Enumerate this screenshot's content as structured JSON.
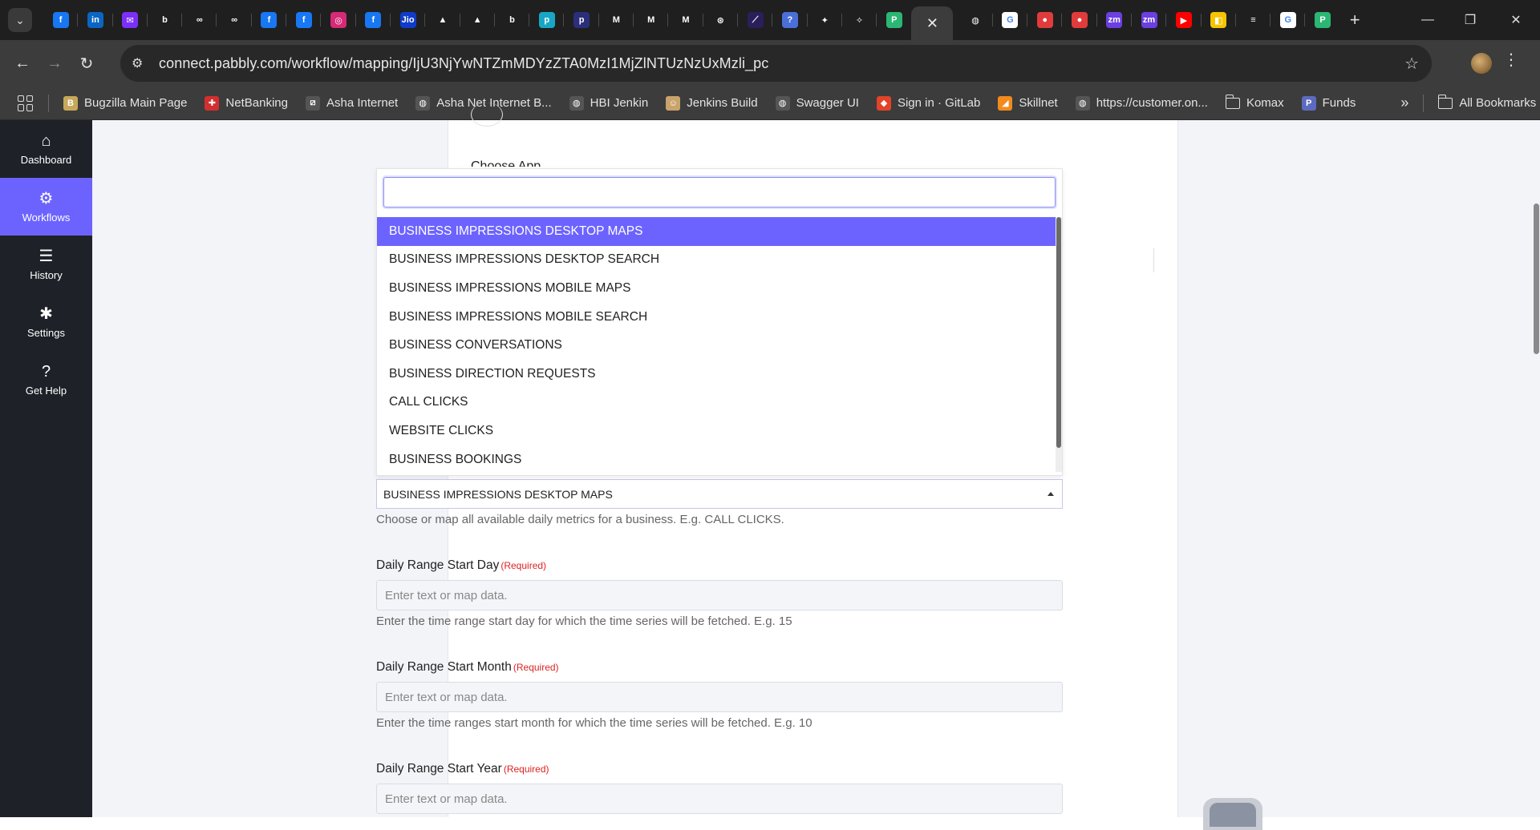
{
  "browser": {
    "tab_icons": [
      {
        "name": "facebook-tab-icon",
        "bg": "#1877f2",
        "glyph": "f"
      },
      {
        "name": "linkedin-tab-icon",
        "bg": "#0a66c2",
        "glyph": "in"
      },
      {
        "name": "mail-tab-icon",
        "bg": "#7b2ff7",
        "glyph": "✉"
      },
      {
        "name": "bonsai-tab-icon",
        "bg": "#1f1f1f",
        "glyph": "b"
      },
      {
        "name": "meta-tab-icon",
        "bg": "#1f1f1f",
        "glyph": "∞"
      },
      {
        "name": "meta-tab-icon",
        "bg": "#1f1f1f",
        "glyph": "∞"
      },
      {
        "name": "facebook-tab-icon",
        "bg": "#1877f2",
        "glyph": "f"
      },
      {
        "name": "facebook-tab-icon",
        "bg": "#1877f2",
        "glyph": "f"
      },
      {
        "name": "instagram-tab-icon",
        "bg": "#d62976",
        "glyph": "◎"
      },
      {
        "name": "facebook-tab-icon",
        "bg": "#1877f2",
        "glyph": "f"
      },
      {
        "name": "jio-tab-icon",
        "bg": "#0f3cc9",
        "glyph": "Jio"
      },
      {
        "name": "app-tab-icon",
        "bg": "#1f1f1f",
        "glyph": "▲"
      },
      {
        "name": "drive-tab-icon",
        "bg": "#1f1f1f",
        "glyph": "▲"
      },
      {
        "name": "bonsai-tab-icon",
        "bg": "#1f1f1f",
        "glyph": "b"
      },
      {
        "name": "app-tab-icon",
        "bg": "#19a6c6",
        "glyph": "p"
      },
      {
        "name": "app-tab-icon",
        "bg": "#2b2f7a",
        "glyph": "p"
      },
      {
        "name": "gmail-tab-icon",
        "bg": "#1f1f1f",
        "glyph": "M"
      },
      {
        "name": "gmail-tab-icon",
        "bg": "#1f1f1f",
        "glyph": "M"
      },
      {
        "name": "gmail-tab-icon",
        "bg": "#1f1f1f",
        "glyph": "M"
      },
      {
        "name": "chatgpt-tab-icon",
        "bg": "#1f1f1f",
        "glyph": "⊛"
      },
      {
        "name": "app-tab-icon",
        "bg": "#2a1f5a",
        "glyph": "⟋"
      },
      {
        "name": "help-tab-icon",
        "bg": "#4a6fd8",
        "glyph": "?"
      },
      {
        "name": "app-tab-icon",
        "bg": "#1f1f1f",
        "glyph": "✦"
      },
      {
        "name": "app-tab-icon",
        "bg": "#1f1f1f",
        "glyph": "✧"
      },
      {
        "name": "pabbly-tab-icon",
        "bg": "#2bb673",
        "glyph": "P"
      }
    ],
    "tab_icons_right": [
      {
        "name": "globe-tab-icon",
        "bg": "#1f1f1f",
        "glyph": "◍"
      },
      {
        "name": "google-tab-icon",
        "bg": "#ffffff",
        "glyph": "G"
      },
      {
        "name": "app-tab-icon",
        "bg": "#e23b3b",
        "glyph": "●"
      },
      {
        "name": "app-tab-icon",
        "bg": "#e23b3b",
        "glyph": "●"
      },
      {
        "name": "zoom-tab-icon",
        "bg": "#6b3fe0",
        "glyph": "zm"
      },
      {
        "name": "zoom-tab-icon",
        "bg": "#6b3fe0",
        "glyph": "zm"
      },
      {
        "name": "youtube-tab-icon",
        "bg": "#ff0000",
        "glyph": "▶"
      },
      {
        "name": "app-tab-icon",
        "bg": "#f5c400",
        "glyph": "◧"
      },
      {
        "name": "stackoverflow-tab-icon",
        "bg": "#1f1f1f",
        "glyph": "≡"
      },
      {
        "name": "google-tab-icon",
        "bg": "#ffffff",
        "glyph": "G"
      },
      {
        "name": "pabbly-tab-icon",
        "bg": "#2bb673",
        "glyph": "P"
      }
    ],
    "active_tab_close": "✕",
    "new_tab": "+",
    "url": "connect.pabbly.com/workflow/mapping/IjU3NjYwNTZmMDYzZTA0MzI1MjZlNTUzNzUxMzli_pc",
    "bookmarks": [
      {
        "label": "Bugzilla Main Page",
        "bg": "#c7a85a",
        "glyph": "B"
      },
      {
        "label": "NetBanking",
        "bg": "#d32f2f",
        "glyph": "✚"
      },
      {
        "label": "Asha Internet",
        "bg": "#555555",
        "glyph": "⧄"
      },
      {
        "label": "Asha Net Internet B...",
        "bg": "#555555",
        "glyph": "◍"
      },
      {
        "label": "HBI Jenkin",
        "bg": "#555555",
        "glyph": "◍"
      },
      {
        "label": "Jenkins Build",
        "bg": "#c9a36b",
        "glyph": "☺"
      },
      {
        "label": "Swagger UI",
        "bg": "#555555",
        "glyph": "◍"
      },
      {
        "label": "Sign in · GitLab",
        "bg": "#e24329",
        "glyph": "◆"
      },
      {
        "label": "Skillnet",
        "bg": "#f28a1c",
        "glyph": "◢"
      },
      {
        "label": "https://customer.on...",
        "bg": "#555555",
        "glyph": "◍"
      }
    ],
    "bookmark_folders": [
      "Komax"
    ],
    "bookmark_funds": {
      "label": "Funds",
      "bg": "#5c6bc0",
      "glyph": "P"
    },
    "overflow": "»",
    "all_bookmarks": "All Bookmarks"
  },
  "sidebar": {
    "items": [
      {
        "label": "Dashboard",
        "icon": "⌂",
        "icon_name": "home-icon",
        "active": false
      },
      {
        "label": "Workflows",
        "icon": "⚙",
        "icon_name": "workflow-icon",
        "active": true
      },
      {
        "label": "History",
        "icon": "☰",
        "icon_name": "history-list-icon",
        "active": false
      },
      {
        "label": "Settings",
        "icon": "✱",
        "icon_name": "gear-icon",
        "active": false
      },
      {
        "label": "Get Help",
        "icon": "?",
        "icon_name": "help-icon",
        "active": false
      }
    ]
  },
  "form": {
    "choose_app_label": "Choose App",
    "dropdown": {
      "search_value": "",
      "options": [
        "BUSINESS IMPRESSIONS DESKTOP MAPS",
        "BUSINESS IMPRESSIONS DESKTOP SEARCH",
        "BUSINESS IMPRESSIONS MOBILE MAPS",
        "BUSINESS IMPRESSIONS MOBILE SEARCH",
        "BUSINESS CONVERSATIONS",
        "BUSINESS DIRECTION REQUESTS",
        "CALL CLICKS",
        "WEBSITE CLICKS",
        "BUSINESS BOOKINGS"
      ],
      "highlighted_index": 0
    },
    "metric_select": {
      "value": "BUSINESS IMPRESSIONS DESKTOP MAPS",
      "help": "Choose or map all available daily metrics for a business. E.g. CALL CLICKS."
    },
    "start_day": {
      "label": "Daily Range Start Day",
      "required": "(Required)",
      "placeholder": "Enter text or map data.",
      "help": "Enter the time range start day for which the time series will be fetched. E.g. 15"
    },
    "start_month": {
      "label": "Daily Range Start Month",
      "required": "(Required)",
      "placeholder": "Enter text or map data.",
      "help": "Enter the time ranges start month for which the time series will be fetched. E.g. 10"
    },
    "start_year": {
      "label": "Daily Range Start Year",
      "required": "(Required)",
      "placeholder": "Enter text or map data."
    }
  },
  "colors": {
    "accent": "#6c63ff",
    "sidebar_bg": "#1e2128",
    "required": "#dd2222"
  }
}
